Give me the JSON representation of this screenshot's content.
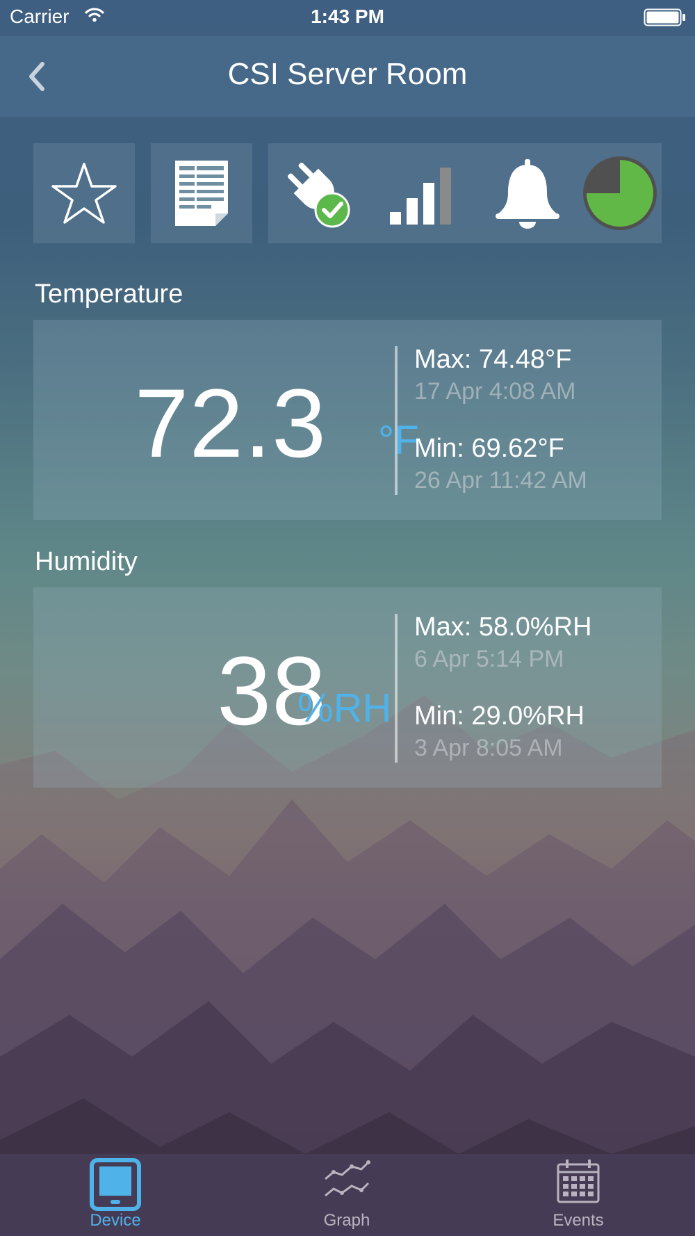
{
  "status_bar": {
    "carrier": "Carrier",
    "time": "1:43 PM",
    "wifi_icon": "wifi-icon",
    "battery_icon": "battery-icon"
  },
  "nav": {
    "title": "CSI Server Room",
    "back_icon": "chevron-left-icon"
  },
  "toolbar": {
    "icons": [
      "star-icon",
      "report-icon",
      "power-plug-check-icon",
      "signal-strength-icon",
      "bell-icon",
      "pie-progress-icon"
    ],
    "progress_fraction": 0.75
  },
  "temperature": {
    "section_title": "Temperature",
    "value": "72.3",
    "unit": "°F",
    "max_label": "Max: 74.48°F",
    "max_time": "17 Apr 4:08 AM",
    "min_label": "Min: 69.62°F",
    "min_time": "26 Apr 11:42 AM"
  },
  "humidity": {
    "section_title": "Humidity",
    "value": "38",
    "unit": "%RH",
    "max_label": "Max: 58.0%RH",
    "max_time": "6 Apr 5:14 PM",
    "min_label": "Min: 29.0%RH",
    "min_time": "3 Apr 8:05 AM"
  },
  "tabs": [
    {
      "label": "Device",
      "icon": "tablet-icon",
      "active": true
    },
    {
      "label": "Graph",
      "icon": "graph-icon",
      "active": false
    },
    {
      "label": "Events",
      "icon": "calendar-icon",
      "active": false
    }
  ],
  "colors": {
    "accent": "#4fb3ea",
    "inactive_tab": "#b9b4c0",
    "connected_green": "#5cb84a",
    "progress_green": "#62b846",
    "progress_ring": "#505050"
  }
}
